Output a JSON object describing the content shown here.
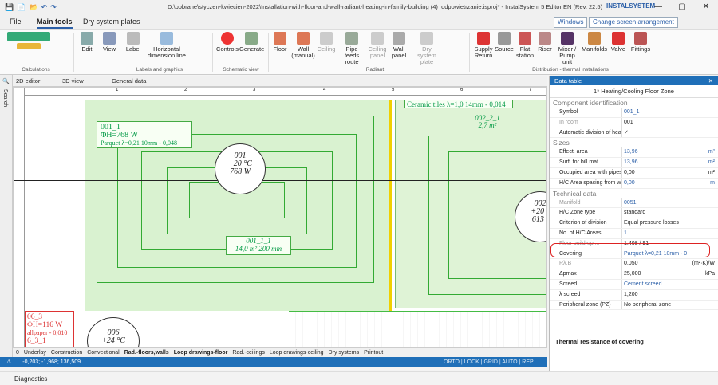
{
  "window": {
    "title": "D:\\pobrane\\styczen-kwiecien-2022\\Installation-with-floor-and-wall-radiant-heating-in-family-building (4)_odpowietrzanie.isproj* - InstalSystem 5 Editor EN (Rev. 22.5)",
    "brand": "INSTALSYSTEM",
    "minimize": "—",
    "maximize": "▢",
    "close": "✕"
  },
  "quick_access": [
    "💾",
    "📄",
    "📂",
    "↶",
    "↷"
  ],
  "tabs": {
    "file": "File",
    "main": "Main tools",
    "dry": "Dry system plates"
  },
  "toolbar_right": {
    "windows": "Windows",
    "change": "Change screen arrangement"
  },
  "ribbon": {
    "items": [
      {
        "label": "Edit",
        "icon": "edit-icon"
      },
      {
        "label": "View",
        "icon": "view-icon"
      },
      {
        "label": "Label",
        "icon": "label-icon"
      },
      {
        "label": "Horizontal dimension line",
        "icon": "dimension-icon"
      },
      {
        "label": "Controls",
        "icon": "controls-icon"
      },
      {
        "label": "Generate",
        "icon": "generate-icon"
      },
      {
        "label": "Floor",
        "icon": "floor-icon"
      },
      {
        "label": "Wall (manual)",
        "icon": "wall-icon"
      },
      {
        "label": "Ceiling",
        "icon": "ceiling-icon"
      },
      {
        "label": "Pipe feeds route",
        "icon": "pipe-icon"
      },
      {
        "label": "Ceiling panel",
        "icon": "ceiling-panel-icon"
      },
      {
        "label": "Wall panel",
        "icon": "wall-panel-icon"
      },
      {
        "label": "Dry system plate",
        "icon": "plate-icon"
      },
      {
        "label": "Supply Return",
        "icon": "supply-icon"
      },
      {
        "label": "Source",
        "icon": "source-icon"
      },
      {
        "label": "Flat station",
        "icon": "flat-icon"
      },
      {
        "label": "Riser",
        "icon": "riser-icon"
      },
      {
        "label": "Mixer / Pump unit",
        "icon": "mixer-icon"
      },
      {
        "label": "Manifolds",
        "icon": "manifold-icon"
      },
      {
        "label": "Valve",
        "icon": "valve-icon"
      },
      {
        "label": "Fittings",
        "icon": "fittings-icon"
      }
    ],
    "groups": {
      "calc": "Calculations",
      "labels": "Labels and graphics",
      "schematic": "Schematic view",
      "radiant": "Radiant",
      "distribution": "Distribution - thermal installations"
    }
  },
  "doc_tabs": {
    "editor2d": "2D editor",
    "view3d": "3D view",
    "general": "General data"
  },
  "left_strip": {
    "search": "Search"
  },
  "drawing": {
    "zone_a": {
      "symbol": "001_1",
      "power": "ΦH=768 W",
      "covering": "Parquet λ=0,21 10mm - 0,048"
    },
    "room_001": {
      "num": "001",
      "temp": "+20 °C",
      "power": "768 W"
    },
    "zone_label": {
      "symbol": "001_1_1",
      "area": "14,0 m²",
      "spacing": "200 mm"
    },
    "ceramic": "Ceramic tiles λ=1,0 14mm - 0,014",
    "zone_b": {
      "symbol": "002_2_1",
      "area": "2,7 m²"
    },
    "room_002": {
      "num": "002",
      "temp": "+20 °",
      "power": "613 \\"
    },
    "room_006": {
      "num": "006",
      "temp": "+24 °C"
    },
    "red_zone": {
      "symbol": "06_3",
      "power": "ΦH=116 W",
      "covering": "allpaper - 0,010",
      "extra": "6_3_1"
    },
    "ruler_marks": [
      "1",
      "2",
      "3",
      "4",
      "5",
      "6",
      "7"
    ]
  },
  "bottom_tabs": [
    "Underlay",
    "Construction",
    "Convectional",
    "Rad.-floors,walls",
    "Loop drawings-floor",
    "Rad.-ceilings",
    "Loop drawings-ceiling",
    "Dry systems",
    "Printout"
  ],
  "bottom_layer": "0",
  "status": {
    "coords": "-0,203; -1,968; 136,509",
    "modes": "ORTO | LOCK | GRID | AUTO | REP"
  },
  "diagnostics": "Diagnostics",
  "panel": {
    "header": "Data table",
    "title": "1* Heating/Cooling Floor Zone",
    "sections": {
      "component": "Component identification",
      "sizes": "Sizes",
      "technical": "Technical data"
    },
    "rows_component": [
      {
        "k": "Symbol",
        "v": "001_1",
        "blue": true,
        "u": ""
      },
      {
        "k": "In room",
        "v": "001",
        "blue": false,
        "u": "",
        "grey": true
      },
      {
        "k": "Automatic division of heatir",
        "v": "✓",
        "blue": false,
        "u": ""
      }
    ],
    "rows_sizes": [
      {
        "k": "Effect. area",
        "v": "13,96",
        "blue": true,
        "u": "m²"
      },
      {
        "k": "Surf. for bill mat.",
        "v": "13,96",
        "blue": true,
        "u": "m²"
      },
      {
        "k": "Occupied area with pipes",
        "v": "0,00",
        "blue": false,
        "u": "m²"
      },
      {
        "k": "H/C Area spacing from wall",
        "v": "0,00",
        "blue": true,
        "u": "m"
      }
    ],
    "rows_tech": [
      {
        "k": "Manifold",
        "v": "0051",
        "blue": true,
        "u": "",
        "grey": true
      },
      {
        "k": "H/C Zone type",
        "v": "standard",
        "blue": false,
        "u": ""
      },
      {
        "k": "Criterion of division",
        "v": "Equal pressure losses",
        "blue": false,
        "u": ""
      },
      {
        "k": "No. of H/C Areas",
        "v": "1",
        "blue": true,
        "u": ""
      },
      {
        "k": "Floor build-up ...",
        "v": "1.408 / 91",
        "blue": false,
        "u": "",
        "grey": true
      },
      {
        "k": "Covering",
        "v": "Parquet λ=0,21 10mm - 0",
        "blue": true,
        "u": ""
      },
      {
        "k": "Rλ,B",
        "v": "0,050",
        "blue": false,
        "u": "(m²·K)/W",
        "grey": true
      },
      {
        "k": "Δpmax",
        "v": "25,000",
        "blue": false,
        "u": "kPa"
      },
      {
        "k": "Screed",
        "v": "Cement screed",
        "blue": true,
        "u": ""
      },
      {
        "k": "λ screed",
        "v": "1,200",
        "blue": false,
        "u": ""
      },
      {
        "k": "Peripheral zone (PZ)",
        "v": "No peripheral zone",
        "blue": false,
        "u": ""
      }
    ],
    "footer": "Thermal resistance of covering"
  }
}
